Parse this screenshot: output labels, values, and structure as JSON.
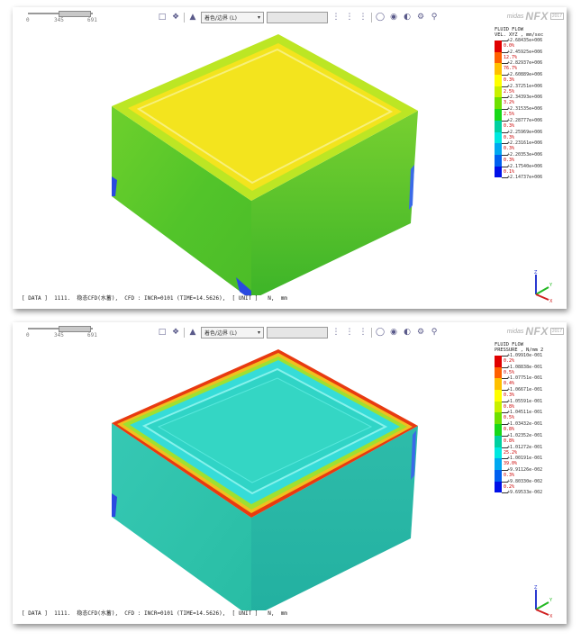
{
  "panels": [
    {
      "ruler": {
        "labels": [
          "0",
          "345",
          "691"
        ]
      },
      "toolbar": {
        "view_dropdown": "着色/边界 (L)",
        "blank_dropdown": ""
      },
      "brand": {
        "prefix": "midas",
        "name": "NFX",
        "tag": "2017"
      },
      "legend": {
        "title1": "FLUID FLOW",
        "title2": "VEL. XYZ , mm/sec",
        "values": [
          "+2.68435e+006",
          "+2.45925e+006",
          "+2.82937e+006",
          "+2.60889e+006",
          "+2.37251e+006",
          "+2.34393e+006",
          "+2.31535e+006",
          "+2.28777e+006",
          "+2.25969e+006",
          "+2.23161e+006",
          "+2.20353e+006",
          "+2.17540e+006",
          "+2.14737e+006"
        ],
        "percents": [
          "0.0%",
          "12.7%",
          "76.7%",
          "0.3%",
          "2.5%",
          "3.2%",
          "2.5%",
          "0.3%",
          "0.3%",
          "0.3%",
          "0.3%",
          "0.1%"
        ],
        "colors": [
          "#e00000",
          "#ff6000",
          "#ffc000",
          "#ffff00",
          "#c8f000",
          "#6ee000",
          "#18d818",
          "#00d0a0",
          "#00e8e0",
          "#00a8f0",
          "#0060f0",
          "#0010e8"
        ]
      },
      "status": "[ DATA ]  1111.  稳态CFD(水蓄),  CFD : INCR=0101 (TIME=14.5626),  [ UNIT ]   N,  mm",
      "colors": {
        "top": "#f0e81e",
        "top_border": "#d6e224",
        "front": "#5ec82c",
        "right": "#56c22a",
        "edge_blue": "#2a4ae0"
      }
    },
    {
      "ruler": {
        "labels": [
          "0",
          "345",
          "691"
        ]
      },
      "toolbar": {
        "view_dropdown": "着色/边界 (L)",
        "blank_dropdown": ""
      },
      "brand": {
        "prefix": "midas",
        "name": "NFX",
        "tag": "2017"
      },
      "legend": {
        "title1": "FLUID FLOW",
        "title2": "PRESSURE , N/mm 2",
        "values": [
          "+1.09910e-001",
          "+1.08838e-001",
          "+1.07751e-001",
          "+1.06671e-001",
          "+1.05591e-001",
          "+1.04511e-001",
          "+1.03432e-001",
          "+1.02352e-001",
          "+1.01272e-001",
          "+1.00191e-001",
          "+9.91126e-002",
          "+9.80330e-002",
          "+9.69533e-002"
        ],
        "percents": [
          "0.2%",
          "0.5%",
          "0.4%",
          "0.3%",
          "0.8%",
          "0.5%",
          "0.8%",
          "0.8%",
          "25.2%",
          "39.0%",
          "0.3%",
          "0.2%"
        ],
        "colors": [
          "#e00000",
          "#ff6000",
          "#ffc000",
          "#ffff00",
          "#c8f000",
          "#6ee000",
          "#18d818",
          "#00d0a0",
          "#00e8e0",
          "#00a8f0",
          "#0060f0",
          "#0010e8"
        ]
      },
      "status": "[ DATA ]  1111.  稳态CFD(水蓄),  CFD : INCR=0101 (TIME=14.5626),  [ UNIT ]   N,  mm",
      "colors": {
        "top": "#38e0d6",
        "top_border": "#78f0e8",
        "front": "#2ec8ac",
        "right": "#22b8a6",
        "edge_red": "#e83a10"
      }
    }
  ]
}
